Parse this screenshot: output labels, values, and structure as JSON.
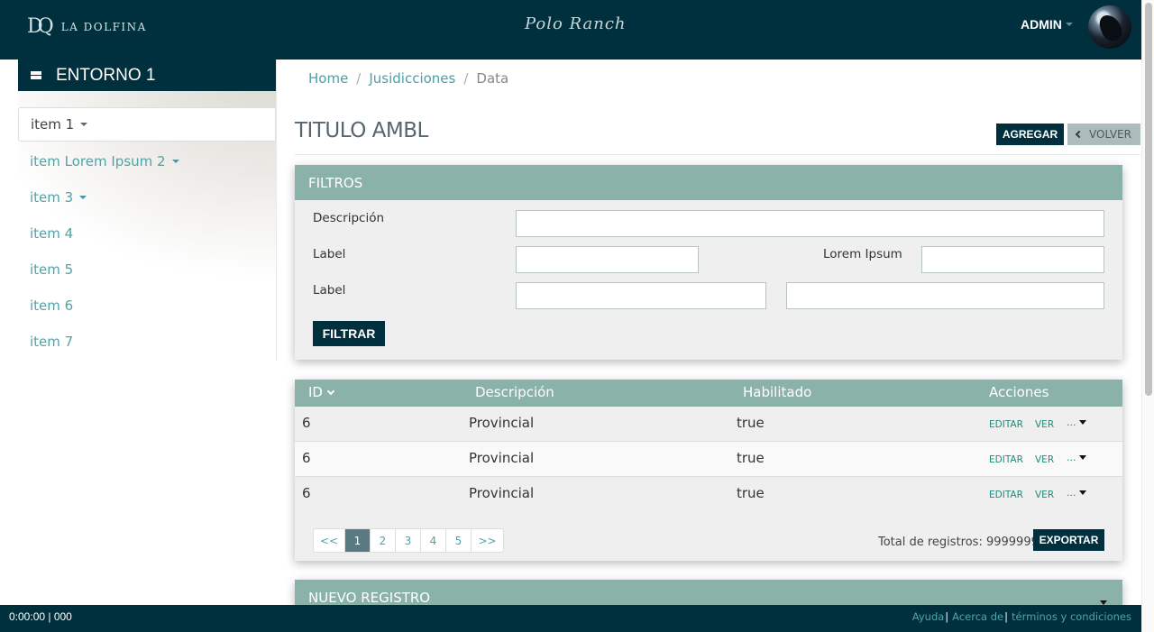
{
  "header": {
    "logo_text": "LA DOLFINA",
    "logo_mark": "DQ",
    "brand": "Polo Ranch",
    "user_label": "ADMIN"
  },
  "sidebar": {
    "title": "ENTORNO 1",
    "items": [
      {
        "label": "item 1",
        "has_dropdown": true,
        "active": true
      },
      {
        "label": "item Lorem Ipsum 2",
        "has_dropdown": true,
        "active": false
      },
      {
        "label": "item 3",
        "has_dropdown": true,
        "active": false
      },
      {
        "label": "item 4",
        "has_dropdown": false,
        "active": false
      },
      {
        "label": "item 5",
        "has_dropdown": false,
        "active": false
      },
      {
        "label": "item 6",
        "has_dropdown": false,
        "active": false
      },
      {
        "label": "item 7",
        "has_dropdown": false,
        "active": false
      }
    ]
  },
  "breadcrumb": {
    "items": [
      "Home",
      "Jusidicciones",
      "Data"
    ],
    "separator": "/"
  },
  "page": {
    "title": "TITULO AMBL",
    "add_label": "AGREGAR",
    "back_label": "VOLVER"
  },
  "filters": {
    "title": "FILTROS",
    "fields": {
      "descripcion": {
        "label": "Descripción",
        "value": ""
      },
      "label1": {
        "label": "Label",
        "value": ""
      },
      "lorem": {
        "label": "Lorem Ipsum",
        "value": ""
      },
      "label2": {
        "label": "Label",
        "value": "",
        "value2": ""
      }
    },
    "submit_label": "FILTRAR"
  },
  "table": {
    "columns": [
      "ID",
      "Descripción",
      "Habilitado",
      "Acciones"
    ],
    "sort_column": "ID",
    "rows": [
      {
        "id": "6",
        "descripcion": "Provincial",
        "habilitado": "true"
      },
      {
        "id": "6",
        "descripcion": "Provincial",
        "habilitado": "true"
      },
      {
        "id": "6",
        "descripcion": "Provincial",
        "habilitado": "true"
      }
    ],
    "actions": {
      "edit": "EDITAR",
      "view": "VER",
      "more": "..."
    },
    "pagination": {
      "first": "<<",
      "pages": [
        "1",
        "2",
        "3",
        "4",
        "5"
      ],
      "current": "1",
      "last": ">>"
    },
    "total_label": "Total de registros: 9999999",
    "export_label": "EXPORTAR"
  },
  "new_record": {
    "title": "NUEVO REGISTRO"
  },
  "footer": {
    "timer": "0:00:00 | 000",
    "links": [
      "Ayuda",
      "Acerca de",
      "términos y condiciones"
    ]
  },
  "colors": {
    "primary_dark": "#00303d",
    "panel_header": "#8ab2a9",
    "link": "#4fa3a9",
    "action": "#1e8a7a",
    "active_page": "#587a80"
  }
}
